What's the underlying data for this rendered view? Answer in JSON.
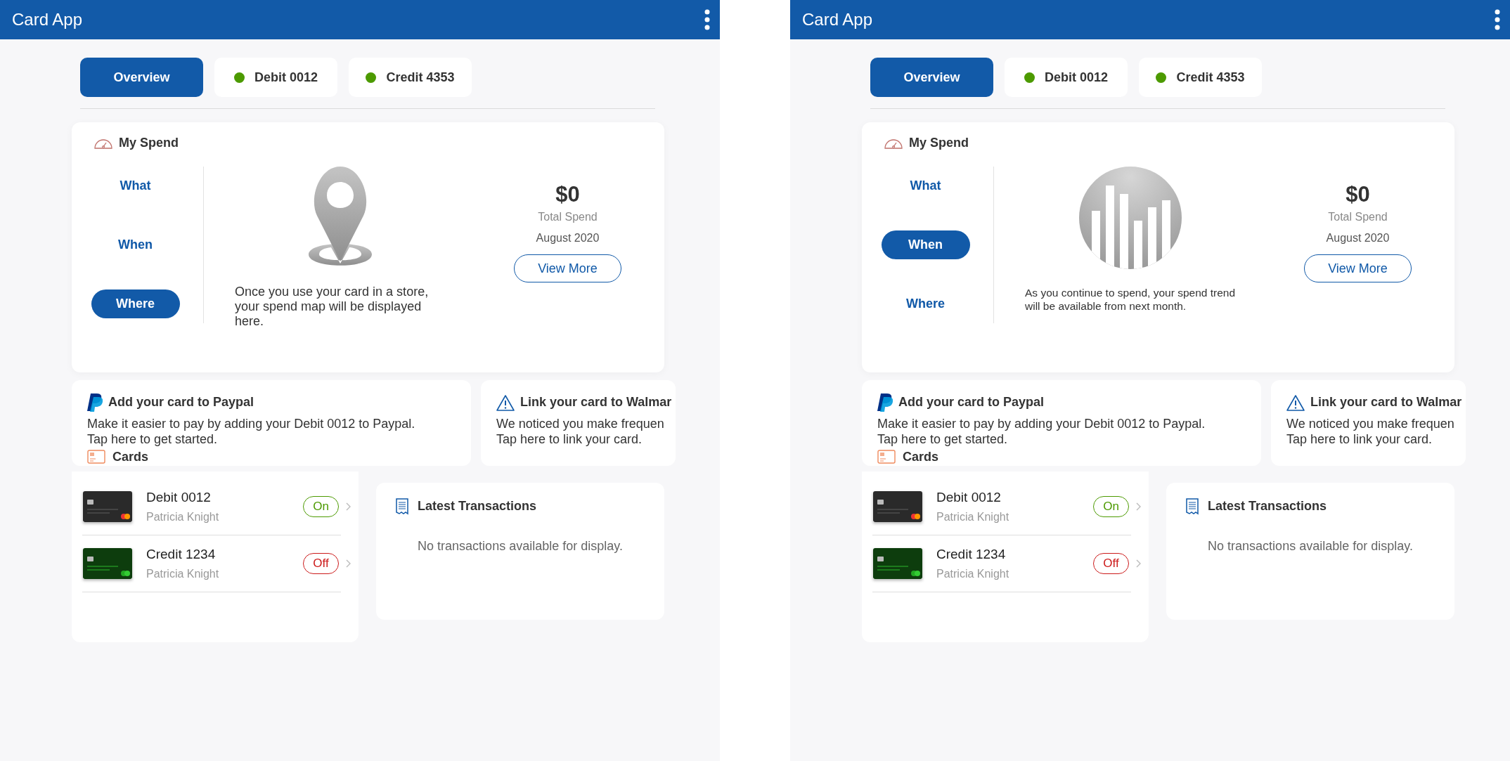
{
  "screens": [
    {
      "header": {
        "title": "Card App"
      },
      "tabs": [
        {
          "label": "Overview",
          "selected": true
        },
        {
          "label": "Debit 0012",
          "selected": false,
          "color": "#4c9a00"
        },
        {
          "label": "Credit 4353",
          "selected": false,
          "color": "#4c9a00"
        }
      ],
      "spend": {
        "title": "My Spend",
        "options": [
          {
            "label": "What",
            "selected": false
          },
          {
            "label": "When",
            "selected": false
          },
          {
            "label": "Where",
            "selected": true
          }
        ],
        "kind": "map",
        "message": "Once you use your card in a store, your spend map will be displayed here.",
        "amount": "$0",
        "amount_label": "Total Spend",
        "period": "August 2020",
        "button": "View More"
      },
      "promos": [
        {
          "kind": "paypal",
          "title": "Add your card to Paypal",
          "lines": [
            "Make it easier to pay by adding your Debit 0012 to Paypal.",
            "Tap here to get started."
          ]
        },
        {
          "kind": "warning",
          "title": "Link your card to Walmar",
          "lines": [
            "We noticed you make frequen",
            "Tap here to link your card."
          ]
        }
      ],
      "cards": {
        "title": "Cards",
        "items": [
          {
            "kind": "debit",
            "name": "Debit 0012",
            "holder": "Patricia Knight",
            "on": true,
            "toggle": "On"
          },
          {
            "kind": "credit",
            "name": "Credit 1234",
            "holder": "Patricia Knight",
            "on": false,
            "toggle": "Off"
          }
        ]
      },
      "transactions": {
        "title": "Latest Transactions",
        "empty": "No transactions available for display."
      }
    },
    {
      "header": {
        "title": "Card App"
      },
      "tabs": [
        {
          "label": "Overview",
          "selected": true
        },
        {
          "label": "Debit 0012",
          "selected": false,
          "color": "#4c9a00"
        },
        {
          "label": "Credit 4353",
          "selected": false,
          "color": "#4c9a00"
        }
      ],
      "spend": {
        "title": "My Spend",
        "options": [
          {
            "label": "What",
            "selected": false
          },
          {
            "label": "When",
            "selected": true
          },
          {
            "label": "Where",
            "selected": false
          }
        ],
        "kind": "trend",
        "message": "As you continue to spend, your spend trend will be available from next month.",
        "amount": "$0",
        "amount_label": "Total Spend",
        "period": "August 2020",
        "button": "View More"
      },
      "promos": [
        {
          "kind": "paypal",
          "title": "Add your card to Paypal",
          "lines": [
            "Make it easier to pay by adding your Debit 0012 to Paypal.",
            "Tap here to get started."
          ]
        },
        {
          "kind": "warning",
          "title": "Link your card to Walmar",
          "lines": [
            "We noticed you make frequen",
            "Tap here to link your card."
          ]
        }
      ],
      "cards": {
        "title": "Cards",
        "items": [
          {
            "kind": "debit",
            "name": "Debit 0012",
            "holder": "Patricia Knight",
            "on": true,
            "toggle": "On"
          },
          {
            "kind": "credit",
            "name": "Credit 1234",
            "holder": "Patricia Knight",
            "on": false,
            "toggle": "Off"
          }
        ]
      },
      "transactions": {
        "title": "Latest Transactions",
        "empty": "No transactions available for display."
      }
    }
  ]
}
